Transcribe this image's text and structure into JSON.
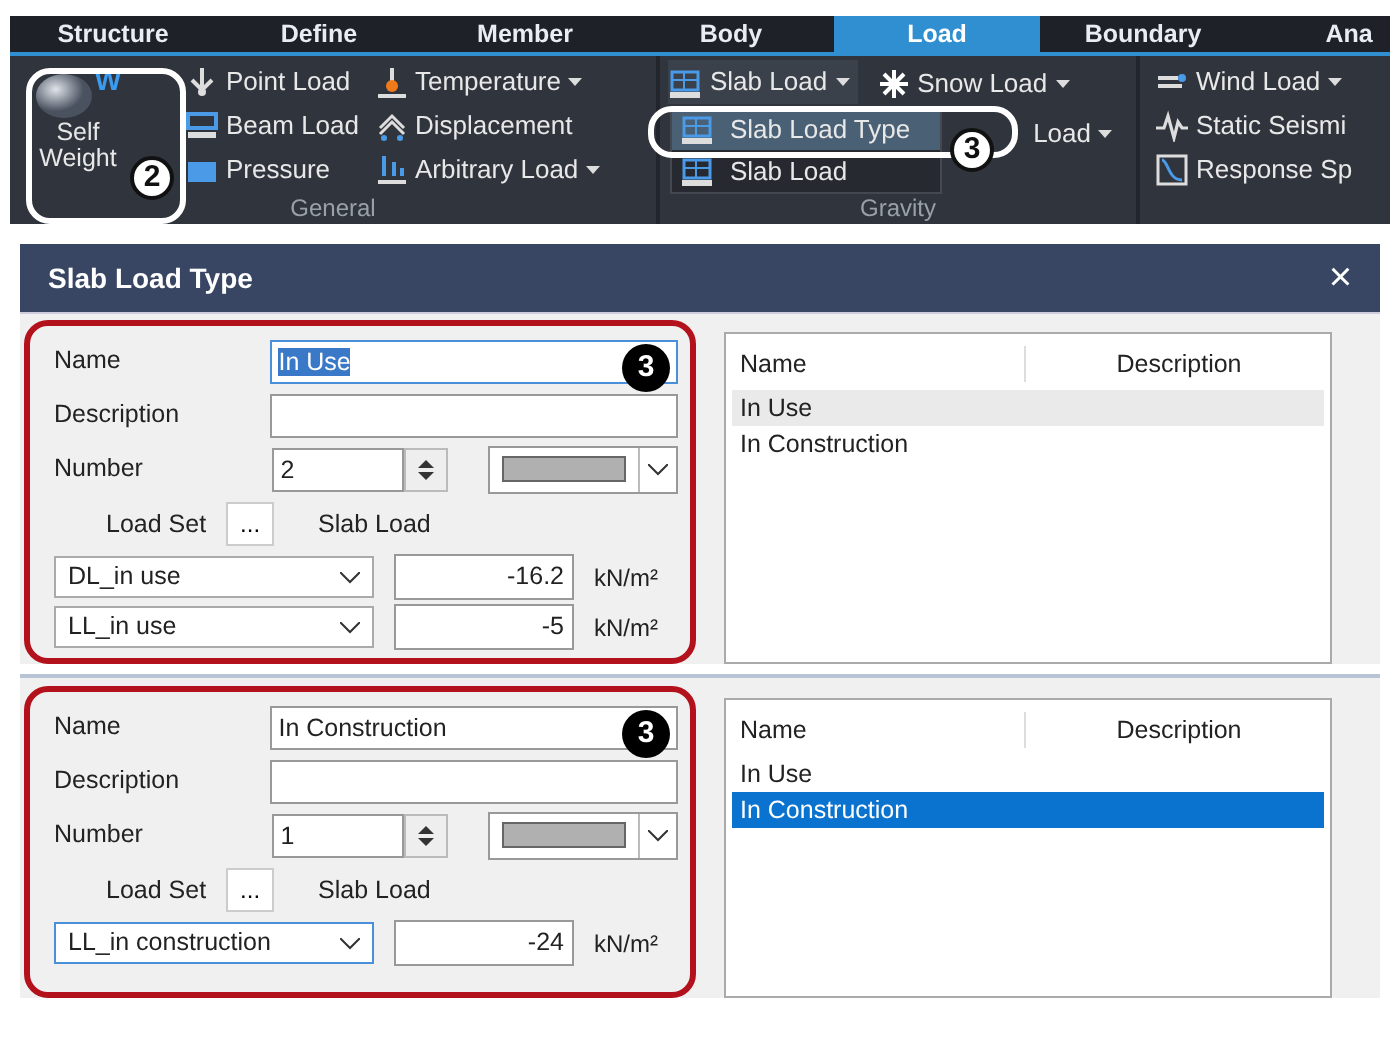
{
  "ribbon": {
    "tabs": [
      {
        "label": "Structure",
        "selected": false
      },
      {
        "label": "Define",
        "selected": false
      },
      {
        "label": "Member",
        "selected": false
      },
      {
        "label": "Body",
        "selected": false
      },
      {
        "label": "Load",
        "selected": true
      },
      {
        "label": "Boundary",
        "selected": false
      },
      {
        "label": "Ana",
        "selected": false
      }
    ],
    "general": {
      "label": "General",
      "self_weight": {
        "label": "Self Weight",
        "badge": "W"
      },
      "columns": [
        [
          {
            "label": "Point Load",
            "dropdown": false
          },
          {
            "label": "Beam Load",
            "dropdown": false
          },
          {
            "label": "Pressure",
            "dropdown": false
          }
        ],
        [
          {
            "label": "Temperature",
            "dropdown": true
          },
          {
            "label": "Displacement",
            "dropdown": false
          },
          {
            "label": "Arbitrary Load",
            "dropdown": true
          }
        ]
      ]
    },
    "gravity": {
      "label": "Gravity",
      "slab_load": {
        "label": "Slab Load",
        "dropdown": true
      },
      "items": [
        {
          "label": "Snow Load",
          "dropdown": true
        },
        {
          "label": "Load",
          "dropdown": true
        }
      ],
      "menu": [
        {
          "label": "Slab Load Type",
          "selected": true
        },
        {
          "label": "Slab Load",
          "selected": false
        }
      ]
    },
    "lateral": {
      "items": [
        {
          "label": "Wind Load",
          "dropdown": true
        },
        {
          "label": "Static Seismi",
          "dropdown": false
        },
        {
          "label": "Response Sp",
          "dropdown": false
        }
      ]
    },
    "callouts": [
      {
        "label": "2"
      },
      {
        "label": "3"
      }
    ]
  },
  "dialogs": [
    {
      "title": "Slab Load Type",
      "close": "×",
      "callout": "3",
      "name": {
        "label": "Name",
        "value": "In Use",
        "text_selected": true
      },
      "description": {
        "label": "Description"
      },
      "number": {
        "label": "Number",
        "value": "2"
      },
      "load_set_label": "Load Set",
      "more": "...",
      "slab_load_label": "Slab Load",
      "loads": [
        {
          "load_set": "DL_in use",
          "value": "-16.2",
          "unit": "kN/m²",
          "focused": false
        },
        {
          "load_set": "LL_in use",
          "value": "-5",
          "unit": "kN/m²",
          "focused": false
        }
      ],
      "list": {
        "columns": [
          "Name",
          "Description"
        ],
        "focused": false,
        "rows": [
          {
            "name": "In Use",
            "selected": true
          },
          {
            "name": "In Construction",
            "selected": false
          }
        ]
      }
    },
    {
      "callout": "3",
      "name": {
        "label": "Name",
        "value": "In Construction",
        "text_selected": false
      },
      "description": {
        "label": "Description"
      },
      "number": {
        "label": "Number",
        "value": "1"
      },
      "load_set_label": "Load Set",
      "more": "...",
      "slab_load_label": "Slab Load",
      "loads": [
        {
          "load_set": "LL_in construction",
          "value": "-24",
          "unit": "kN/m²",
          "focused": true
        }
      ],
      "list": {
        "columns": [
          "Name",
          "Description"
        ],
        "focused": true,
        "rows": [
          {
            "name": "In Use",
            "selected": false
          },
          {
            "name": "In Construction",
            "selected": true
          }
        ]
      }
    }
  ]
}
